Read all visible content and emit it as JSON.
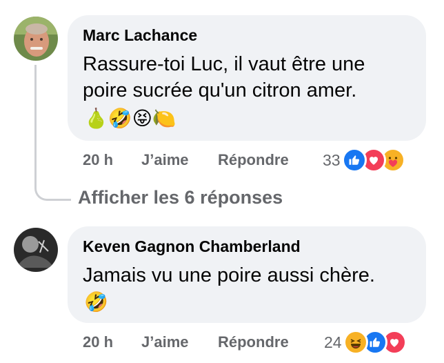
{
  "comments": [
    {
      "author": "Marc Lachance",
      "text": "Rassure-toi Luc, il vaut être une poire sucrée qu'un citron amer.",
      "emojis": "🍐🤣😝🍋",
      "time": "20 h",
      "like_label": "J’aime",
      "reply_label": "Répondre",
      "reaction_count": "33",
      "reactions": [
        "like-icon",
        "love-icon",
        "care-icon"
      ]
    },
    {
      "author": "Keven Gagnon Chamberland",
      "text": "Jamais vu une poire aussi chère.",
      "emojis": "🤣",
      "time": "20 h",
      "like_label": "J’aime",
      "reply_label": "Répondre",
      "reaction_count": "24",
      "reactions": [
        "haha-icon",
        "like-icon",
        "love-icon"
      ]
    }
  ],
  "replies_link": "Afficher les 6 réponses",
  "colors": {
    "like": "#1877f2",
    "love": "#f33e58",
    "care": "#f7b125",
    "bubble": "#f0f2f5",
    "secondary": "#65676b"
  }
}
